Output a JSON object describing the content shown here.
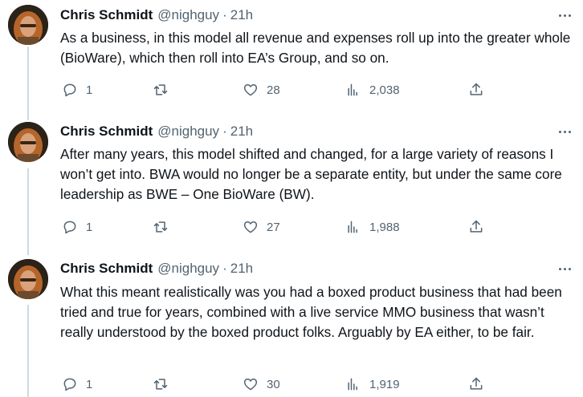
{
  "author": {
    "name": "Chris Schmidt",
    "handle": "@nighguy",
    "avatar_icon": "avatar-photo"
  },
  "tweets": [
    {
      "time": "21h",
      "text": "As a business, in this model all revenue and expenses roll up into the greater whole (BioWare), which then roll into EA’s Group, and so on.",
      "replies": "1",
      "retweets": "",
      "likes": "28",
      "views": "2,038"
    },
    {
      "time": "21h",
      "text": "After many years, this model shifted and changed, for a large variety of reasons I won’t get into. BWA would no longer be a separate entity, but under the same core leadership as BWE – One BioWare (BW).",
      "replies": "1",
      "retweets": "",
      "likes": "27",
      "views": "1,988"
    },
    {
      "time": "21h",
      "text": "What this meant realistically was you had a boxed product business that had been tried and true for years, combined with a live service MMO business that wasn’t really understood by the boxed product folks. Arguably by EA either, to be fair.",
      "replies": "1",
      "retweets": "",
      "likes": "30",
      "views": "1,919"
    }
  ],
  "separator": "·",
  "colors": {
    "text": "#0f1419",
    "muted": "#536471",
    "thread_line": "#cfd9de"
  }
}
